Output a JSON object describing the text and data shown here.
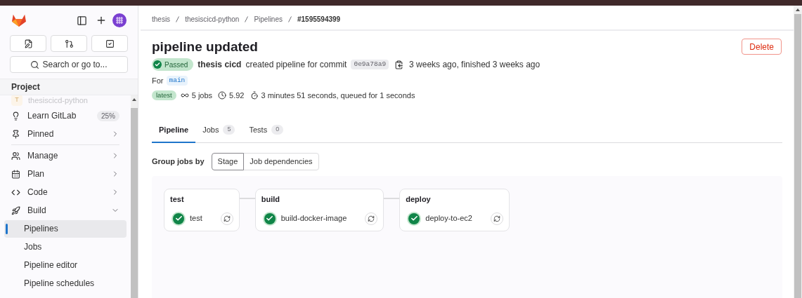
{
  "sidebar": {
    "search": {
      "placeholder": "Search or go to..."
    },
    "section_title": "Project",
    "project": {
      "initial": "T",
      "name": "thesiscicd-python"
    },
    "items": [
      {
        "label": "Learn GitLab",
        "badge": "25%"
      },
      {
        "label": "Pinned",
        "expanded": false
      },
      {
        "label": "Manage",
        "expanded": false
      },
      {
        "label": "Plan",
        "expanded": false
      },
      {
        "label": "Code",
        "expanded": false
      },
      {
        "label": "Build",
        "expanded": true,
        "children": [
          {
            "label": "Pipelines",
            "selected": true
          },
          {
            "label": "Jobs",
            "selected": false
          },
          {
            "label": "Pipeline editor",
            "selected": false
          },
          {
            "label": "Pipeline schedules",
            "selected": false
          }
        ]
      }
    ]
  },
  "breadcrumb": [
    {
      "label": "thesis",
      "current": false
    },
    {
      "label": "thesiscicd-python",
      "current": false
    },
    {
      "label": "Pipelines",
      "current": false
    },
    {
      "label": "#1595594399",
      "current": true
    }
  ],
  "title": "pipeline updated",
  "delete_button": "Delete",
  "status": {
    "kind": "passed",
    "label": "Passed"
  },
  "author": "thesis cicd",
  "created_text": "created pipeline for commit",
  "commit": "0e9a78a9",
  "time_text": "3 weeks ago, finished 3 weeks ago",
  "ref_prefix": "For",
  "ref": "main",
  "latest_badge": "latest",
  "jobs_count": "5 jobs",
  "compute": "5.92",
  "duration": "3 minutes 51 seconds, queued for 1 seconds",
  "tabs": [
    {
      "label": "Pipeline",
      "selected": true
    },
    {
      "label": "Jobs",
      "count": "5",
      "selected": false
    },
    {
      "label": "Tests",
      "count": "0",
      "selected": false
    }
  ],
  "group_by": {
    "label": "Group jobs by",
    "options": [
      {
        "label": "Stage",
        "selected": true
      },
      {
        "label": "Job dependencies",
        "selected": false
      }
    ]
  },
  "stages": [
    {
      "name": "test",
      "jobs": [
        {
          "name": "test",
          "kind": "passed"
        }
      ]
    },
    {
      "name": "build",
      "jobs": [
        {
          "name": "build-docker-image",
          "kind": "passed"
        }
      ]
    },
    {
      "name": "deploy",
      "jobs": [
        {
          "name": "deploy-to-ec2",
          "kind": "passed"
        }
      ]
    }
  ]
}
